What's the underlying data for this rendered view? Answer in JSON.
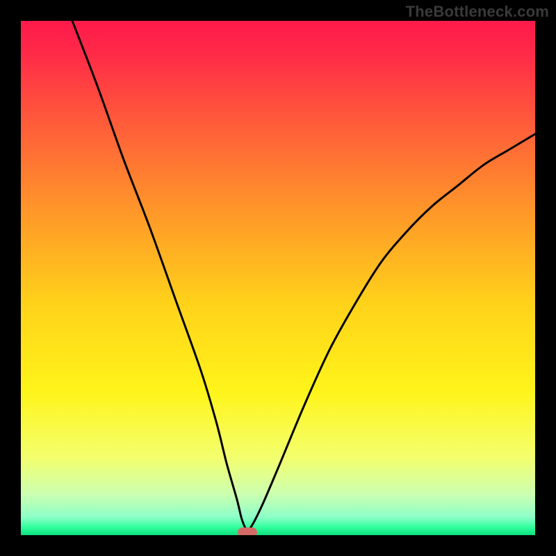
{
  "watermark": "TheBottleneck.com",
  "chart_data": {
    "type": "line",
    "title": "",
    "xlabel": "",
    "ylabel": "",
    "xlim": [
      0,
      100
    ],
    "ylim": [
      0,
      100
    ],
    "grid": false,
    "legend": false,
    "series": [
      {
        "name": "bottleneck-curve",
        "x": [
          10,
          15,
          20,
          25,
          30,
          35,
          38,
          40,
          42,
          43,
          44,
          45,
          47,
          50,
          55,
          60,
          65,
          70,
          75,
          80,
          85,
          90,
          95,
          100
        ],
        "y": [
          100,
          87,
          73,
          60,
          46,
          32,
          22,
          14,
          7,
          3,
          1,
          2,
          6,
          13,
          25,
          36,
          45,
          53,
          59,
          64,
          68,
          72,
          75,
          78
        ]
      }
    ],
    "marker": {
      "x": 44,
      "y": 0.5,
      "color": "#d46a66"
    },
    "background_gradient": {
      "stops": [
        {
          "pos": 0.0,
          "color": "#ff1a4b"
        },
        {
          "pos": 0.06,
          "color": "#ff2948"
        },
        {
          "pos": 0.2,
          "color": "#ff5c3a"
        },
        {
          "pos": 0.38,
          "color": "#ff9a28"
        },
        {
          "pos": 0.55,
          "color": "#ffd21a"
        },
        {
          "pos": 0.72,
          "color": "#fff41a"
        },
        {
          "pos": 0.85,
          "color": "#f3ff6e"
        },
        {
          "pos": 0.92,
          "color": "#ccffb0"
        },
        {
          "pos": 0.965,
          "color": "#8dffc8"
        },
        {
          "pos": 0.985,
          "color": "#2fff9c"
        },
        {
          "pos": 1.0,
          "color": "#0cde7e"
        }
      ]
    }
  },
  "colors": {
    "curve": "#000000",
    "marker": "#d46a66",
    "frame": "#000000"
  }
}
